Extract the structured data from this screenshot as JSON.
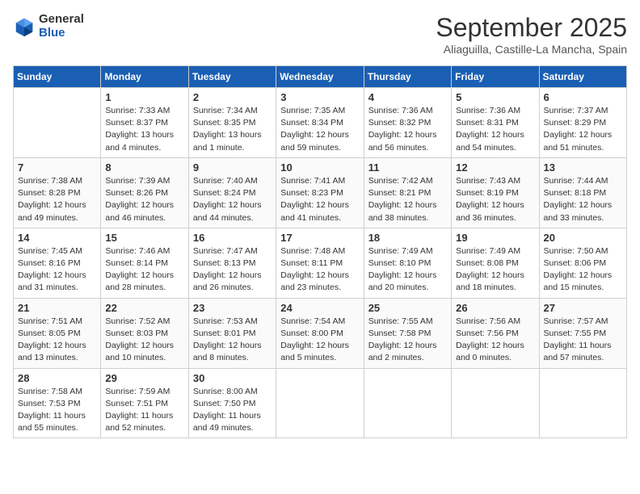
{
  "logo": {
    "general": "General",
    "blue": "Blue"
  },
  "header": {
    "month": "September 2025",
    "location": "Aliaguilla, Castille-La Mancha, Spain"
  },
  "weekdays": [
    "Sunday",
    "Monday",
    "Tuesday",
    "Wednesday",
    "Thursday",
    "Friday",
    "Saturday"
  ],
  "weeks": [
    [
      {
        "day": "",
        "info": ""
      },
      {
        "day": "1",
        "info": "Sunrise: 7:33 AM\nSunset: 8:37 PM\nDaylight: 13 hours\nand 4 minutes."
      },
      {
        "day": "2",
        "info": "Sunrise: 7:34 AM\nSunset: 8:35 PM\nDaylight: 13 hours\nand 1 minute."
      },
      {
        "day": "3",
        "info": "Sunrise: 7:35 AM\nSunset: 8:34 PM\nDaylight: 12 hours\nand 59 minutes."
      },
      {
        "day": "4",
        "info": "Sunrise: 7:36 AM\nSunset: 8:32 PM\nDaylight: 12 hours\nand 56 minutes."
      },
      {
        "day": "5",
        "info": "Sunrise: 7:36 AM\nSunset: 8:31 PM\nDaylight: 12 hours\nand 54 minutes."
      },
      {
        "day": "6",
        "info": "Sunrise: 7:37 AM\nSunset: 8:29 PM\nDaylight: 12 hours\nand 51 minutes."
      }
    ],
    [
      {
        "day": "7",
        "info": "Sunrise: 7:38 AM\nSunset: 8:28 PM\nDaylight: 12 hours\nand 49 minutes."
      },
      {
        "day": "8",
        "info": "Sunrise: 7:39 AM\nSunset: 8:26 PM\nDaylight: 12 hours\nand 46 minutes."
      },
      {
        "day": "9",
        "info": "Sunrise: 7:40 AM\nSunset: 8:24 PM\nDaylight: 12 hours\nand 44 minutes."
      },
      {
        "day": "10",
        "info": "Sunrise: 7:41 AM\nSunset: 8:23 PM\nDaylight: 12 hours\nand 41 minutes."
      },
      {
        "day": "11",
        "info": "Sunrise: 7:42 AM\nSunset: 8:21 PM\nDaylight: 12 hours\nand 38 minutes."
      },
      {
        "day": "12",
        "info": "Sunrise: 7:43 AM\nSunset: 8:19 PM\nDaylight: 12 hours\nand 36 minutes."
      },
      {
        "day": "13",
        "info": "Sunrise: 7:44 AM\nSunset: 8:18 PM\nDaylight: 12 hours\nand 33 minutes."
      }
    ],
    [
      {
        "day": "14",
        "info": "Sunrise: 7:45 AM\nSunset: 8:16 PM\nDaylight: 12 hours\nand 31 minutes."
      },
      {
        "day": "15",
        "info": "Sunrise: 7:46 AM\nSunset: 8:14 PM\nDaylight: 12 hours\nand 28 minutes."
      },
      {
        "day": "16",
        "info": "Sunrise: 7:47 AM\nSunset: 8:13 PM\nDaylight: 12 hours\nand 26 minutes."
      },
      {
        "day": "17",
        "info": "Sunrise: 7:48 AM\nSunset: 8:11 PM\nDaylight: 12 hours\nand 23 minutes."
      },
      {
        "day": "18",
        "info": "Sunrise: 7:49 AM\nSunset: 8:10 PM\nDaylight: 12 hours\nand 20 minutes."
      },
      {
        "day": "19",
        "info": "Sunrise: 7:49 AM\nSunset: 8:08 PM\nDaylight: 12 hours\nand 18 minutes."
      },
      {
        "day": "20",
        "info": "Sunrise: 7:50 AM\nSunset: 8:06 PM\nDaylight: 12 hours\nand 15 minutes."
      }
    ],
    [
      {
        "day": "21",
        "info": "Sunrise: 7:51 AM\nSunset: 8:05 PM\nDaylight: 12 hours\nand 13 minutes."
      },
      {
        "day": "22",
        "info": "Sunrise: 7:52 AM\nSunset: 8:03 PM\nDaylight: 12 hours\nand 10 minutes."
      },
      {
        "day": "23",
        "info": "Sunrise: 7:53 AM\nSunset: 8:01 PM\nDaylight: 12 hours\nand 8 minutes."
      },
      {
        "day": "24",
        "info": "Sunrise: 7:54 AM\nSunset: 8:00 PM\nDaylight: 12 hours\nand 5 minutes."
      },
      {
        "day": "25",
        "info": "Sunrise: 7:55 AM\nSunset: 7:58 PM\nDaylight: 12 hours\nand 2 minutes."
      },
      {
        "day": "26",
        "info": "Sunrise: 7:56 AM\nSunset: 7:56 PM\nDaylight: 12 hours\nand 0 minutes."
      },
      {
        "day": "27",
        "info": "Sunrise: 7:57 AM\nSunset: 7:55 PM\nDaylight: 11 hours\nand 57 minutes."
      }
    ],
    [
      {
        "day": "28",
        "info": "Sunrise: 7:58 AM\nSunset: 7:53 PM\nDaylight: 11 hours\nand 55 minutes."
      },
      {
        "day": "29",
        "info": "Sunrise: 7:59 AM\nSunset: 7:51 PM\nDaylight: 11 hours\nand 52 minutes."
      },
      {
        "day": "30",
        "info": "Sunrise: 8:00 AM\nSunset: 7:50 PM\nDaylight: 11 hours\nand 49 minutes."
      },
      {
        "day": "",
        "info": ""
      },
      {
        "day": "",
        "info": ""
      },
      {
        "day": "",
        "info": ""
      },
      {
        "day": "",
        "info": ""
      }
    ]
  ]
}
